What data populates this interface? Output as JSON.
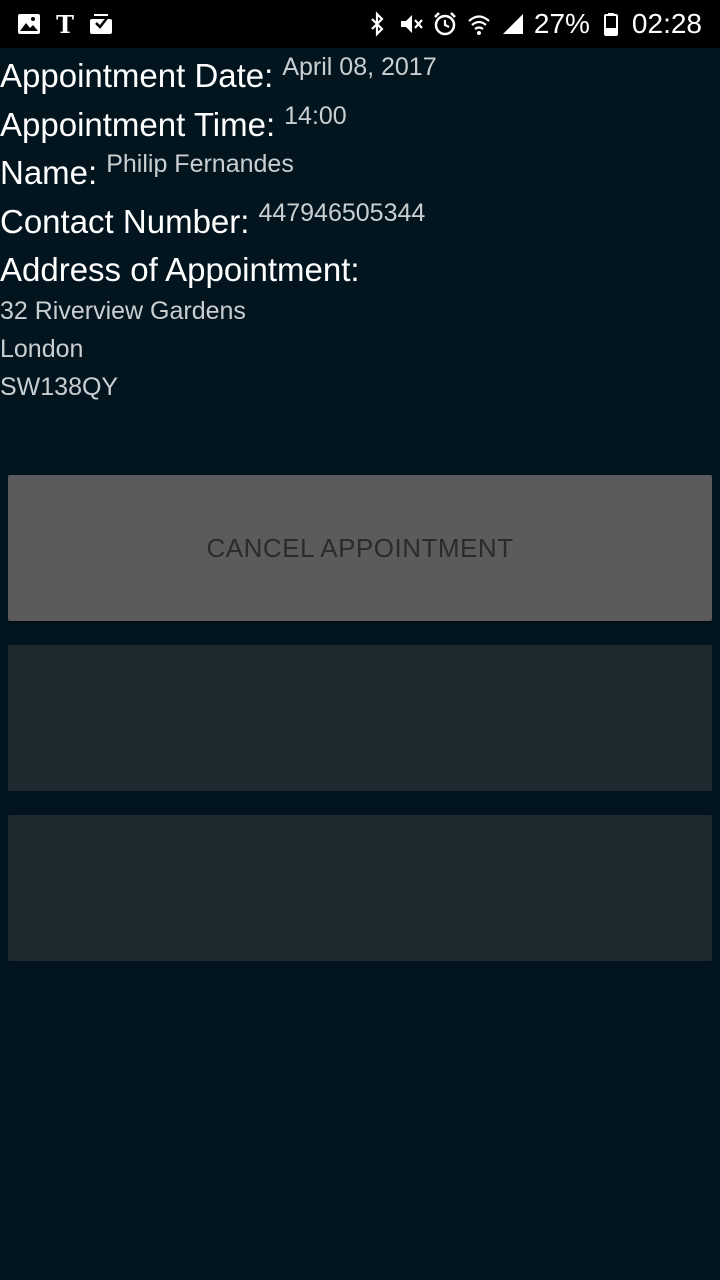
{
  "status_bar": {
    "left_icons": [
      "image-icon",
      "nyt-icon",
      "inbox-icon"
    ],
    "right_icons": [
      "bluetooth-icon",
      "mute-icon",
      "alarm-icon",
      "wifi-icon",
      "signal-icon"
    ],
    "battery_percent": "27%",
    "time": "02:28"
  },
  "details": {
    "date_label": "Appointment Date:",
    "date_value": "April 08, 2017",
    "time_label": "Appointment Time:",
    "time_value": "14:00",
    "name_label": "Name:",
    "name_value": "Philip Fernandes",
    "contact_label": "Contact Number:",
    "contact_value": "447946505344",
    "address_label": "Address of Appointment:",
    "address_lines": [
      "32 Riverview Gardens",
      "London",
      "SW138QY"
    ]
  },
  "buttons": {
    "cancel_label": "CANCEL APPOINTMENT",
    "second_label": "",
    "third_label": ""
  },
  "colors": {
    "background": "#02151e",
    "primary_button": "#5b5b5d",
    "disabled_button": "#1e2a30"
  }
}
